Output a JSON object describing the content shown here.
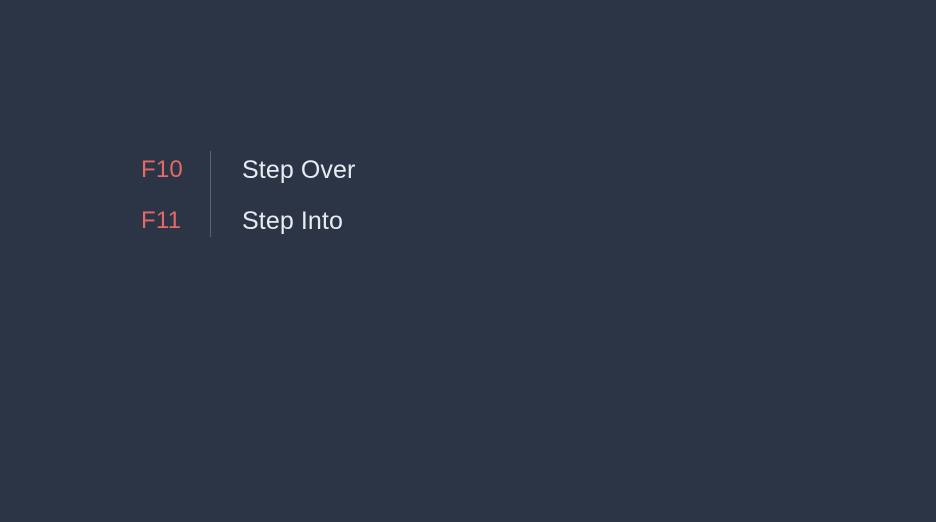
{
  "colors": {
    "background": "#2b3545",
    "key_text": "#e36966",
    "action_text": "#e7ebf1",
    "divider": "#56637a"
  },
  "shortcuts": [
    {
      "key": "F10",
      "action": "Step Over"
    },
    {
      "key": "F11",
      "action": "Step Into"
    }
  ]
}
